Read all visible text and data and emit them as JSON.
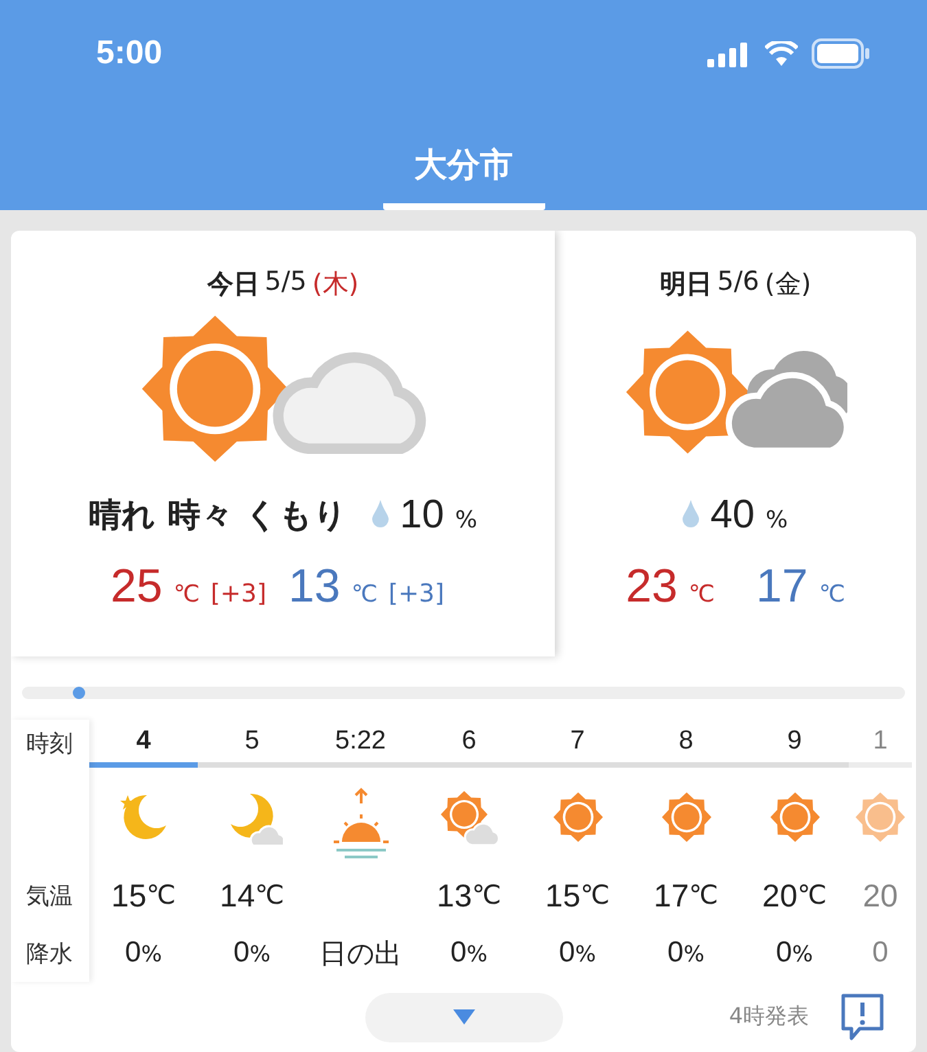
{
  "status_bar": {
    "time": "5:00"
  },
  "header": {
    "title": "大分市"
  },
  "days": [
    {
      "label": "今日",
      "date": "5/5",
      "weekday": "(木)",
      "holiday": true,
      "selected": true,
      "kind": "sun-cloud-light",
      "weather": "晴れ 時々 くもり",
      "precip": "10",
      "precip_unit": "%",
      "high": "25",
      "high_unit": "℃",
      "high_diff": "[+3]",
      "low": "13",
      "low_unit": "℃",
      "low_diff": "[+3]"
    },
    {
      "label": "明日",
      "date": "5/6",
      "weekday": "(金)",
      "holiday": false,
      "selected": false,
      "kind": "sun-cloud-dark",
      "precip": "40",
      "precip_unit": "%",
      "high": "23",
      "high_unit": "℃",
      "low": "17",
      "low_unit": "℃"
    }
  ],
  "hourly": {
    "row_labels": [
      "時刻",
      "気温",
      "降水"
    ],
    "columns": [
      {
        "kind": "moon-star",
        "time": "4",
        "temp": "15",
        "temp_unit": "℃",
        "precip": "0",
        "precip_unit": "%",
        "selected": true,
        "faded": false
      },
      {
        "kind": "moon-cloud",
        "time": "5",
        "temp": "14",
        "temp_unit": "℃",
        "precip": "0",
        "precip_unit": "%",
        "selected": false,
        "faded": false
      },
      {
        "kind": "sunrise",
        "time": "5:22",
        "note": "日の出",
        "selected": false,
        "faded": false
      },
      {
        "kind": "sun-cloud",
        "time": "6",
        "temp": "13",
        "temp_unit": "℃",
        "precip": "0",
        "precip_unit": "%",
        "selected": false,
        "faded": false
      },
      {
        "kind": "sun",
        "time": "7",
        "temp": "15",
        "temp_unit": "℃",
        "precip": "0",
        "precip_unit": "%",
        "selected": false,
        "faded": false
      },
      {
        "kind": "sun",
        "time": "8",
        "temp": "17",
        "temp_unit": "℃",
        "precip": "0",
        "precip_unit": "%",
        "selected": false,
        "faded": false
      },
      {
        "kind": "sun",
        "time": "9",
        "temp": "20",
        "temp_unit": "℃",
        "precip": "0",
        "precip_unit": "%",
        "selected": false,
        "faded": false
      },
      {
        "kind": "sun",
        "time": "1",
        "temp": "20",
        "precip": "0",
        "selected": false,
        "faded": true
      }
    ]
  },
  "footer": {
    "issued": "4時発表"
  }
}
